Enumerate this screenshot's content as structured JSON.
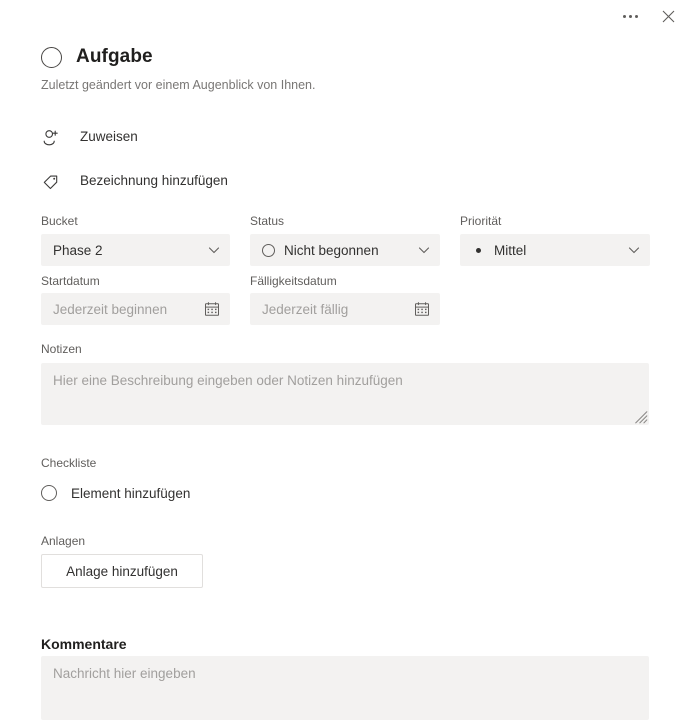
{
  "window": {
    "more_options_label": "...",
    "close_label": "✕",
    "more_icon": "ellipsis-icon",
    "close_icon": "close-icon"
  },
  "header": {
    "completion_icon": "circle-incomplete-icon",
    "title": "Aufgabe",
    "subtitle": "Zuletzt geändert vor einem Augenblick von Ihnen."
  },
  "actions": [
    {
      "icon": "assign-person-icon",
      "label": "Zuweisen"
    },
    {
      "icon": "tag-label-icon",
      "label": "Bezeichnung hinzufügen"
    }
  ],
  "fields": {
    "bucket": {
      "label": "Bucket",
      "value": "Phase 2",
      "chevron_icon": "chevron-down-icon"
    },
    "status": {
      "label": "Status",
      "value": "Nicht begonnen",
      "status_icon": "circle-incomplete-icon",
      "chevron_icon": "chevron-down-icon"
    },
    "priority": {
      "label": "Priorität",
      "value": "Mittel",
      "priority_icon": "dot-medium-icon",
      "chevron_icon": "chevron-down-icon"
    },
    "start_date": {
      "label": "Startdatum",
      "value": "",
      "placeholder": "Jederzeit beginnen",
      "calendar_icon": "calendar-icon"
    },
    "due_date": {
      "label": "Fälligkeitsdatum",
      "value": "",
      "placeholder": "Jederzeit fällig",
      "calendar_icon": "calendar-icon"
    },
    "notes": {
      "label": "Notizen",
      "value": "",
      "placeholder": "Hier eine Beschreibung eingeben oder Notizen hinzufügen"
    }
  },
  "checklist": {
    "label": "Checkliste",
    "add_item_label": "Element hinzufügen",
    "add_item_icon": "circle-incomplete-icon"
  },
  "attachments": {
    "label": "Anlagen",
    "add_button_label": "Anlage hinzufügen"
  },
  "comments": {
    "heading": "Kommentare",
    "value": "",
    "placeholder": "Nachricht hier eingeben"
  },
  "colors": {
    "field_background": "#f3f2f1",
    "page_background": "#ffffff",
    "text_primary": "#323130",
    "text_secondary": "#605e5c",
    "placeholder": "#a19f9d",
    "border": "#e1dfdd"
  }
}
